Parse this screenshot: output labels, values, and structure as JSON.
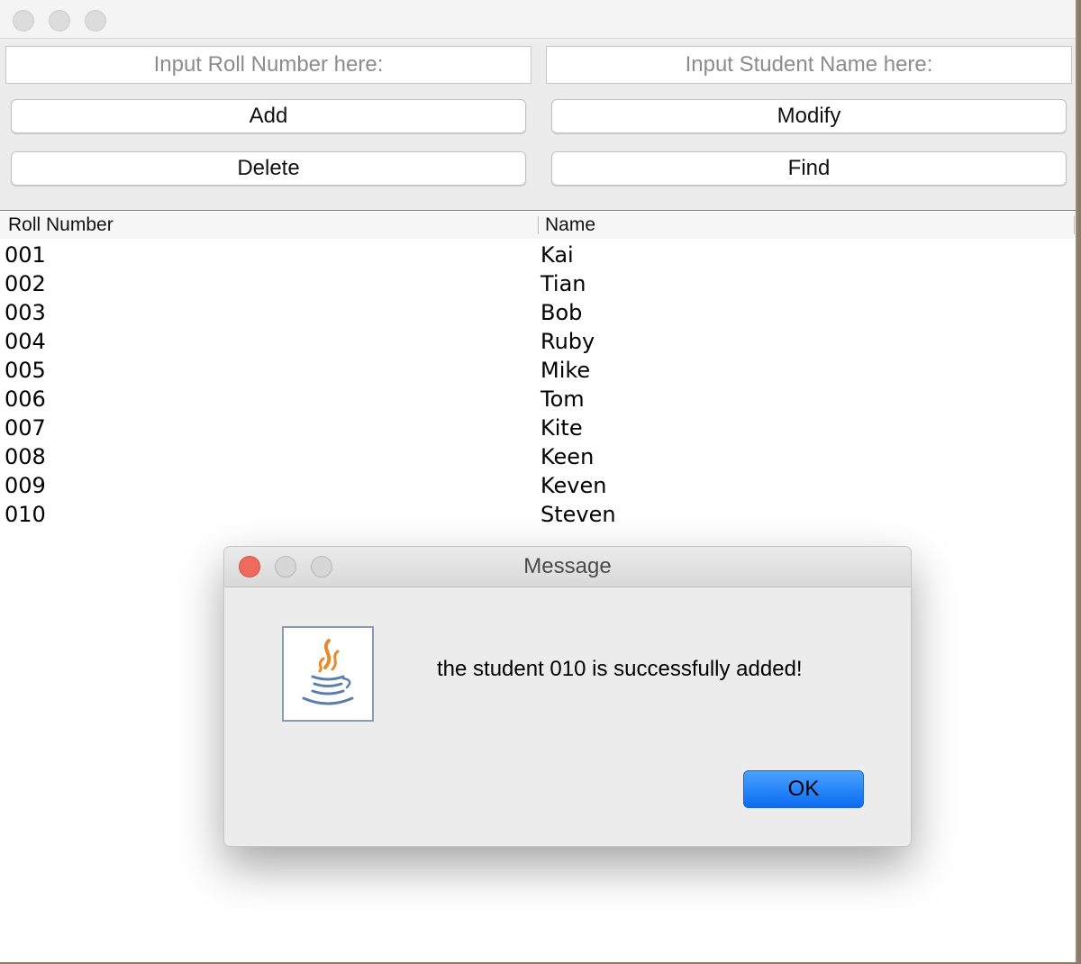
{
  "inputs": {
    "roll_placeholder": "Input Roll Number here:",
    "name_placeholder": "Input Student Name here:"
  },
  "buttons": {
    "add": "Add",
    "modify": "Modify",
    "delete": "Delete",
    "find": "Find"
  },
  "table": {
    "headers": [
      "Roll Number",
      "Name"
    ],
    "rows": [
      [
        "001",
        "Kai"
      ],
      [
        "002",
        "Tian"
      ],
      [
        "003",
        "Bob"
      ],
      [
        "004",
        "Ruby"
      ],
      [
        "005",
        "Mike"
      ],
      [
        "006",
        "Tom"
      ],
      [
        "007",
        "Kite"
      ],
      [
        "008",
        "Keen"
      ],
      [
        "009",
        "Keven"
      ],
      [
        "010",
        "Steven"
      ]
    ]
  },
  "dialog": {
    "title": "Message",
    "message": "the student 010 is successfully added!",
    "ok_label": "OK",
    "icon": "java-icon"
  },
  "colors": {
    "close_button": "#ee6a5f",
    "ok_button": "#1a7cff"
  }
}
